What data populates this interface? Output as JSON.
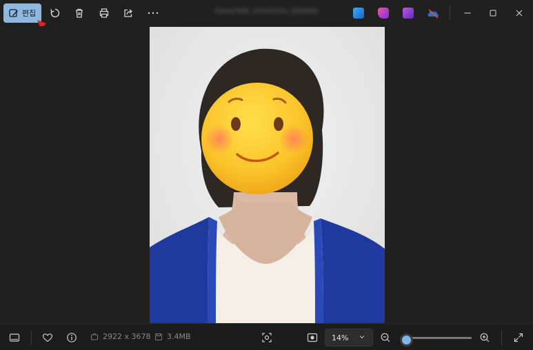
{
  "toolbar": {
    "edit_label": "편집",
    "edit_icon": "edit-image-icon",
    "rotate_icon": "rotate-icon",
    "delete_icon": "trash-icon",
    "print_icon": "print-icon",
    "share_icon": "share-icon",
    "more_icon": "more-icon",
    "filename": "KakaoTalk_20240101_000000_01.jpg",
    "accent": "#8fb8e0"
  },
  "apps": [
    {
      "name": "designer-app-icon",
      "color": "#2e7fd6"
    },
    {
      "name": "clipchamp-app-icon",
      "color": "#c13ad9"
    },
    {
      "name": "video-app-icon",
      "color": "#8a4bd9"
    },
    {
      "name": "onedrive-icon",
      "color": "#2b78c5"
    }
  ],
  "window": {
    "minimize_icon": "minimize-icon",
    "maximize_icon": "maximize-icon",
    "close_icon": "close-icon"
  },
  "bottom": {
    "filmstrip_icon": "filmstrip-icon",
    "favorite_icon": "heart-icon",
    "info_icon": "info-icon",
    "dimensions": "2922 x 3678",
    "file_size": "3.4MB",
    "fit_icon": "fit-to-window-icon",
    "actual_size_icon": "actual-size-icon",
    "zoom_value": "14%",
    "zoom_fraction": 0.06,
    "zoom_out_icon": "zoom-out-icon",
    "zoom_in_icon": "zoom-in-icon",
    "fullscreen_icon": "fullscreen-icon"
  }
}
